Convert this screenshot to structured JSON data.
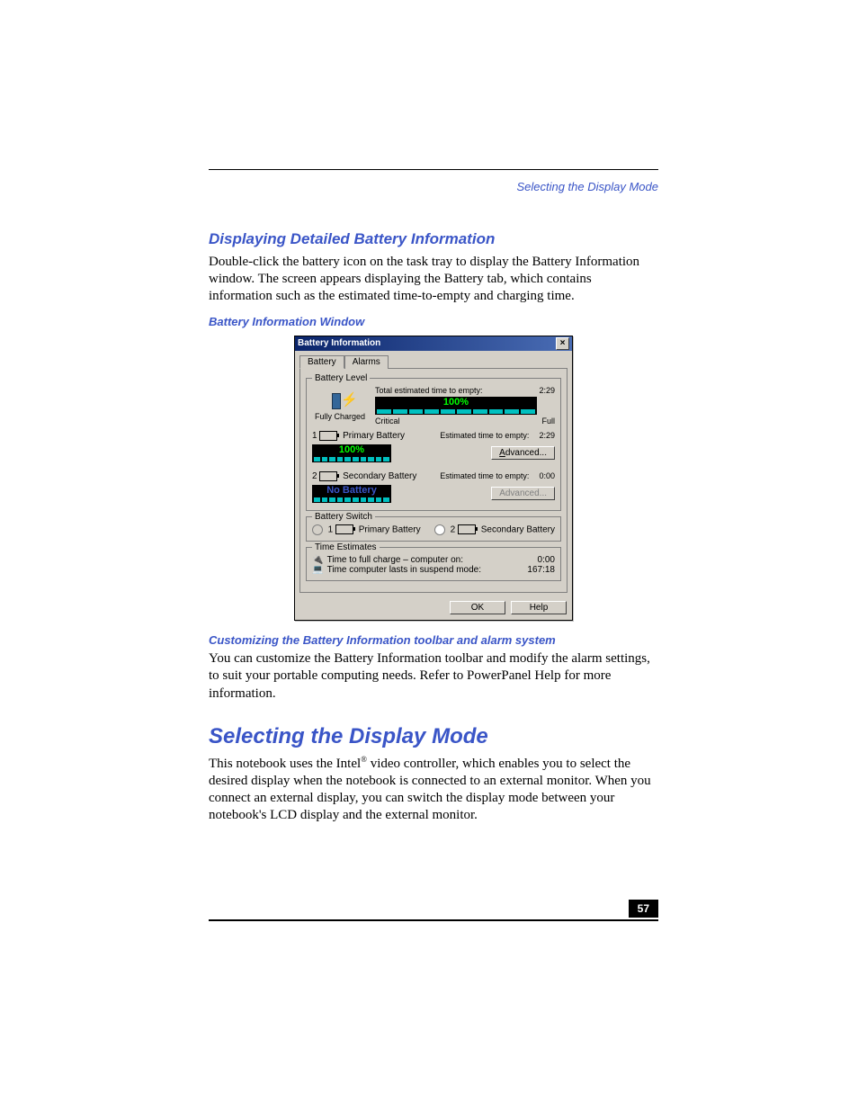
{
  "header": {
    "running_title": "Selecting the Display Mode"
  },
  "sections": {
    "s1_title": "Displaying Detailed Battery Information",
    "s1_body": "Double-click the battery icon on the task tray to display the Battery Information window. The screen appears displaying the Battery tab, which contains information such as the estimated time-to-empty and charging time.",
    "caption1": "Battery Information Window",
    "s2_title": "Customizing the Battery Information toolbar and alarm system",
    "s2_body": "You can customize the Battery Information toolbar and modify the alarm settings, to suit your portable computing needs. Refer to PowerPanel Help for more information.",
    "s3_title": "Selecting the Display Mode",
    "s3_body_a": "This notebook uses the Intel",
    "s3_body_b": " video controller, which enables you to select the desired display when the notebook is connected to an external monitor. When you connect an external display, you can switch the display mode between your notebook's LCD display and the external monitor.",
    "reg_mark": "®"
  },
  "dialog": {
    "title": "Battery Information",
    "tabs": {
      "battery": "Battery",
      "alarms": "Alarms"
    },
    "level": {
      "legend": "Battery Level",
      "fully_charged": "Fully Charged",
      "total_label": "Total estimated time to empty:",
      "total_value": "2:29",
      "percent": "100%",
      "critical": "Critical",
      "full": "Full"
    },
    "primary": {
      "num": "1",
      "name": "Primary Battery",
      "est_label": "Estimated time to empty:",
      "est_value": "2:29",
      "percent": "100%",
      "advanced": "Advanced..."
    },
    "secondary": {
      "num": "2",
      "name": "Secondary Battery",
      "est_label": "Estimated time to empty:",
      "est_value": "0:00",
      "status": "No Battery",
      "advanced": "Advanced..."
    },
    "switch": {
      "legend": "Battery Switch",
      "opt1_num": "1",
      "opt1": "Primary Battery",
      "opt2_num": "2",
      "opt2": "Secondary Battery"
    },
    "estimates": {
      "legend": "Time Estimates",
      "row1_label": "Time to full charge – computer on:",
      "row1_value": "0:00",
      "row2_label": "Time computer lasts in suspend mode:",
      "row2_value": "167:18"
    },
    "buttons": {
      "ok": "OK",
      "help": "Help"
    }
  },
  "footer": {
    "page": "57"
  }
}
